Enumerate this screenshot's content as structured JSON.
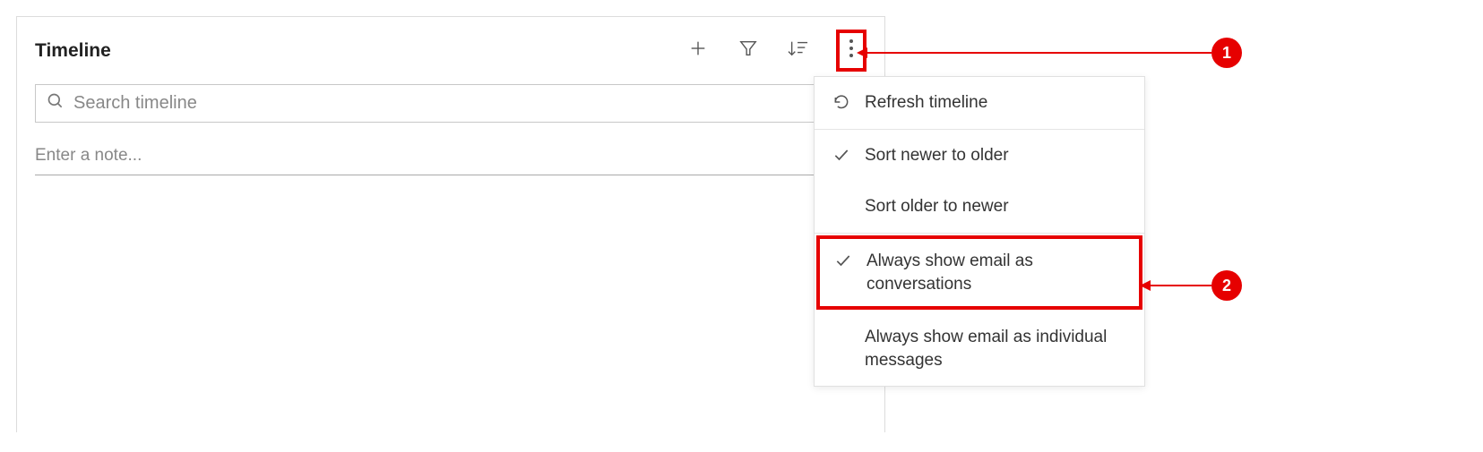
{
  "timeline": {
    "title": "Timeline",
    "search_placeholder": "Search timeline",
    "note_placeholder": "Enter a note..."
  },
  "menu": {
    "refresh": "Refresh timeline",
    "sort_newer": "Sort newer to older",
    "sort_older": "Sort older to newer",
    "email_conversations": "Always show email as conversations",
    "email_individual": "Always show email as individual messages"
  },
  "callouts": {
    "c1": "1",
    "c2": "2"
  }
}
